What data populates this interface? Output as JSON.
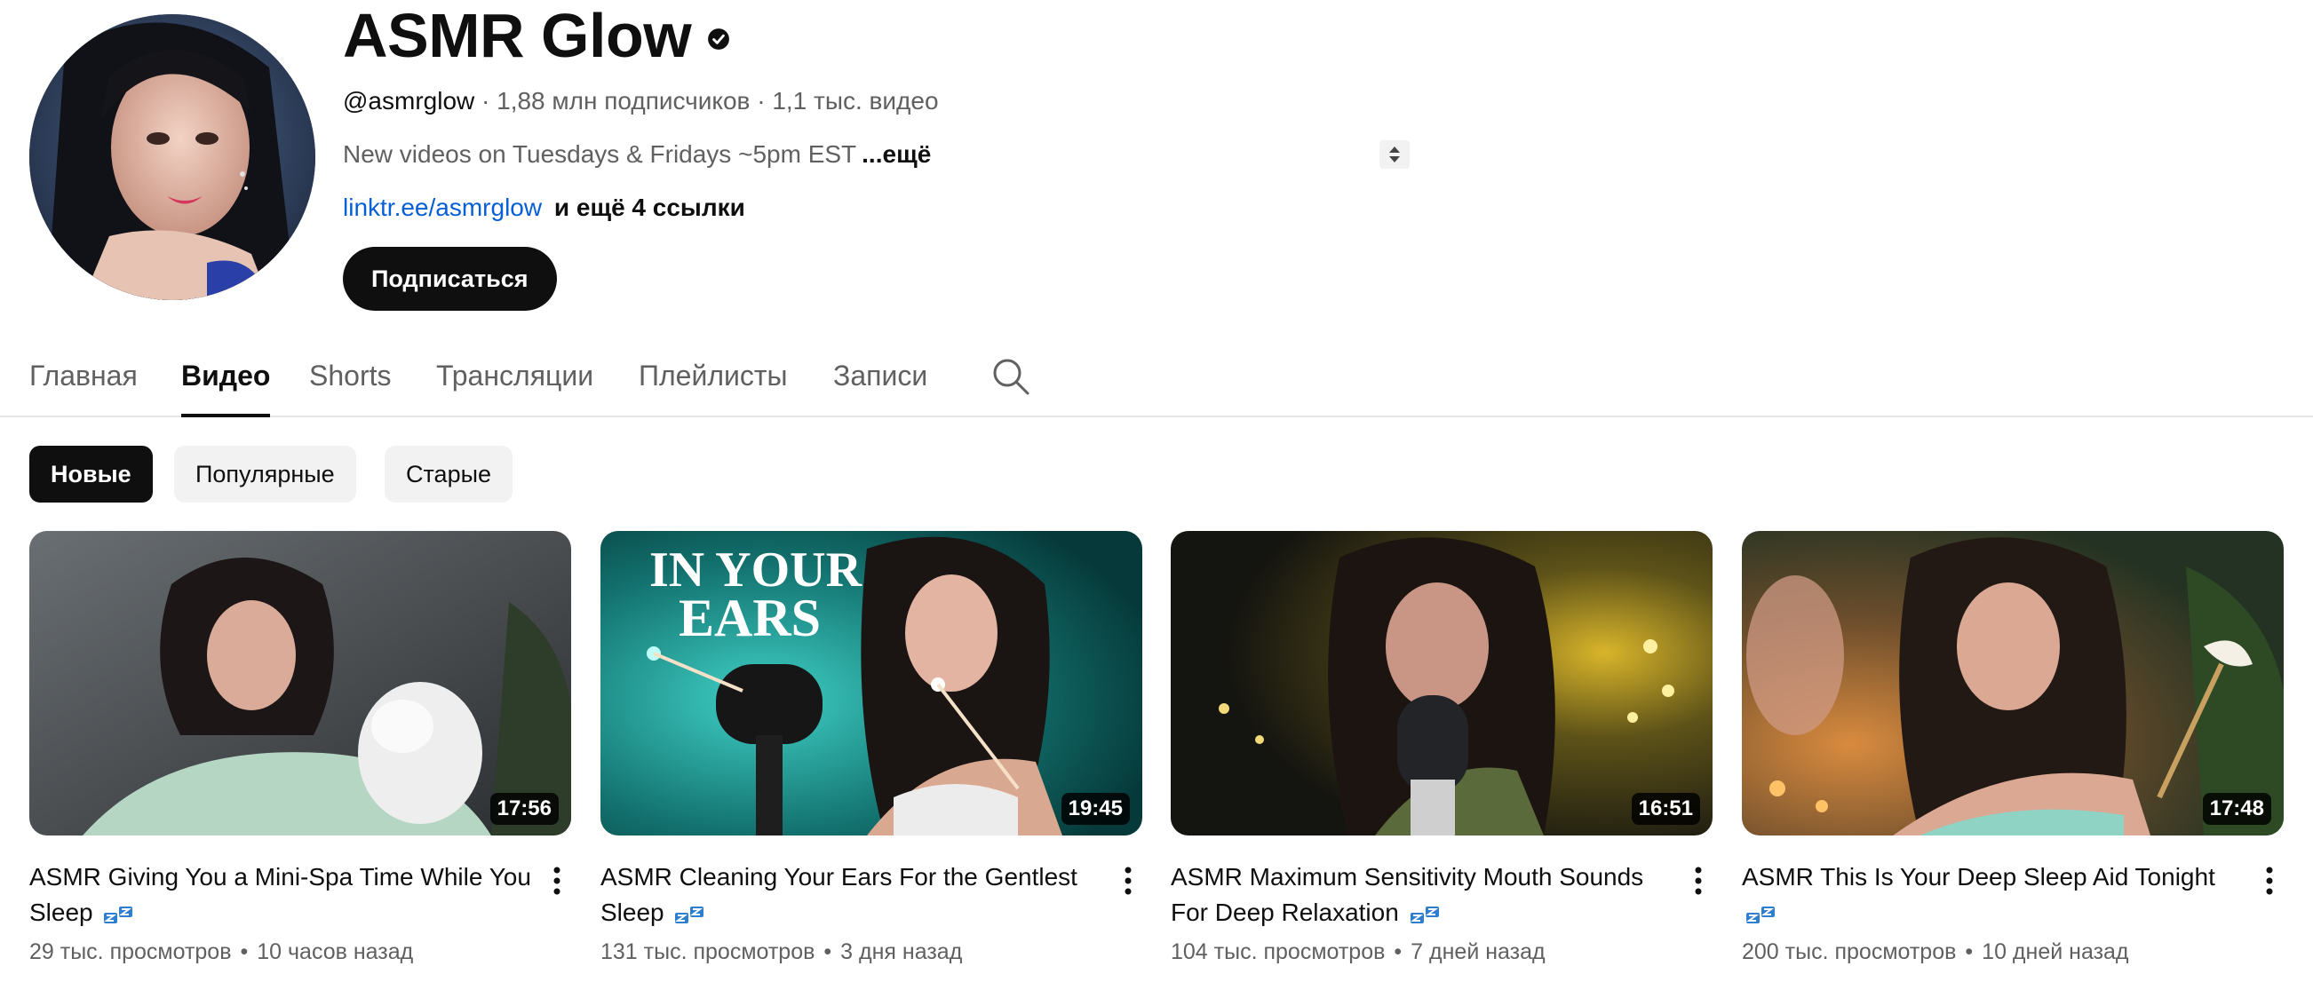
{
  "channel": {
    "name": "ASMR Glow",
    "handle": "@asmrglow",
    "subscribers": "1,88 млн подписчиков",
    "video_count": "1,1 тыс. видео",
    "separator": "·",
    "description": "New videos on Tuesdays & Fridays ~5pm EST",
    "description_more": "...ещё",
    "link": "linktr.ee/asmrglow",
    "more_links": "и ещё 4 ссылки",
    "subscribe_label": "Подписаться"
  },
  "tabs": [
    {
      "label": "Главная",
      "active": false
    },
    {
      "label": "Видео",
      "active": true
    },
    {
      "label": "Shorts",
      "active": false
    },
    {
      "label": "Трансляции",
      "active": false
    },
    {
      "label": "Плейлисты",
      "active": false
    },
    {
      "label": "Записи",
      "active": false
    }
  ],
  "chips": [
    {
      "label": "Новые",
      "active": true
    },
    {
      "label": "Популярные",
      "active": false
    },
    {
      "label": "Старые",
      "active": false
    }
  ],
  "videos": [
    {
      "title": "ASMR Giving You a Mini-Spa Time While You Sleep",
      "duration": "17:56",
      "views": "29 тыс. просмотров",
      "age": "10 часов назад"
    },
    {
      "title": "ASMR Cleaning Your Ears For the Gentlest Sleep",
      "duration": "19:45",
      "views": "131 тыс. просмотров",
      "age": "3 дня назад",
      "thumb_text": [
        "IN YOUR",
        "EARS"
      ]
    },
    {
      "title": "ASMR Maximum Sensitivity Mouth Sounds For Deep Relaxation",
      "duration": "16:51",
      "views": "104 тыс. просмотров",
      "age": "7 дней назад"
    },
    {
      "title": "ASMR This Is Your Deep Sleep Aid Tonight",
      "duration": "17:48",
      "views": "200 тыс. просмотров",
      "age": "10 дней назад"
    }
  ],
  "stats_separator": "•",
  "icons": {
    "verified": "verified-check-icon",
    "search": "search-icon",
    "kebab": "more-vert-icon",
    "sleep": "zzz-sleep-emoji-icon"
  }
}
